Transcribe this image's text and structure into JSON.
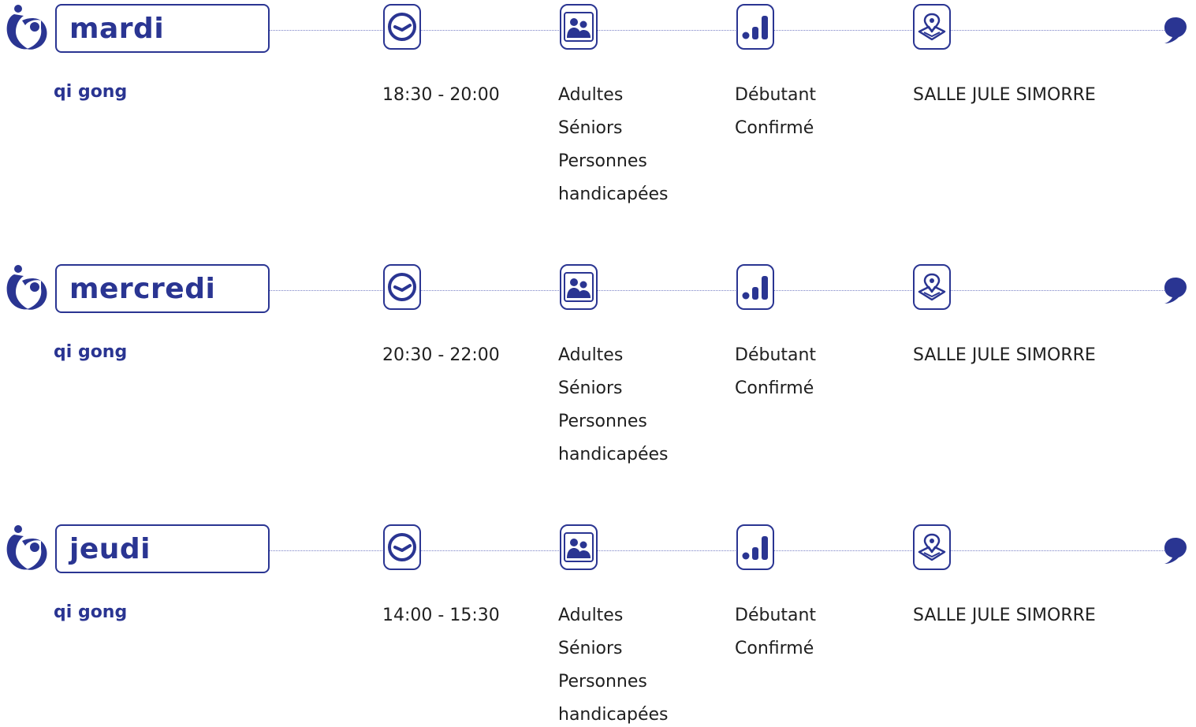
{
  "colors": {
    "brand": "#2a3592",
    "dotted_line": "#7b82c6",
    "text": "#1f1f1f"
  },
  "icons": {
    "logo": "people-circle-logo",
    "time": "clock-icon",
    "public": "people-icon",
    "level": "signal-bars-icon",
    "place": "map-pin-icon",
    "more": "speech-bubble-icon"
  },
  "sessions": [
    {
      "day": "mardi",
      "activity": "qi gong",
      "time": "18:30 - 20:00",
      "public": [
        "Adultes",
        "Séniors",
        "Personnes",
        "handicapées"
      ],
      "levels": [
        "Débutant",
        "Confirmé"
      ],
      "place": "SALLE JULE SIMORRE"
    },
    {
      "day": "mercredi",
      "activity": "qi gong",
      "time": "20:30 - 22:00",
      "public": [
        "Adultes",
        "Séniors",
        "Personnes",
        "handicapées"
      ],
      "levels": [
        "Débutant",
        "Confirmé"
      ],
      "place": "SALLE JULE SIMORRE"
    },
    {
      "day": "jeudi",
      "activity": "qi gong",
      "time": "14:00 - 15:30",
      "public": [
        "Adultes",
        "Séniors",
        "Personnes",
        "handicapées"
      ],
      "levels": [
        "Débutant",
        "Confirmé"
      ],
      "place": "SALLE JULE SIMORRE"
    }
  ]
}
